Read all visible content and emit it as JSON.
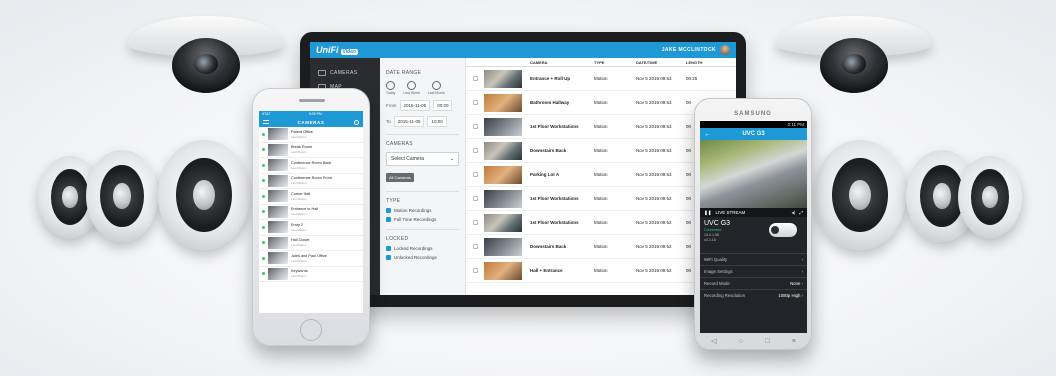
{
  "tablet": {
    "logo": "UniFi",
    "logo_badge": "Video",
    "user": "JAKE MCCLINTOCK",
    "sidebar": [
      {
        "label": "CAMERAS",
        "icon": "camera-icon"
      },
      {
        "label": "MAP",
        "icon": "map-icon"
      }
    ],
    "filters": {
      "date_range_heading": "DATE RANGE",
      "quick_ranges": [
        "Today",
        "Last Week",
        "Last Month"
      ],
      "from_label": "From",
      "from_date": "2015-11-05",
      "from_time": "00:00",
      "to_label": "To",
      "to_date": "2015-11-05",
      "to_time": "10:00",
      "cameras_heading": "CAMERAS",
      "select_camera": "Select Camera",
      "all_cameras_chip": "All Cameras",
      "type_heading": "TYPE",
      "type_options": [
        "Motion Recordings",
        "Full Time Recordings"
      ],
      "locked_heading": "LOCKED",
      "locked_options": [
        "Locked Recordings",
        "Unlocked Recordings"
      ]
    },
    "table": {
      "headers": [
        "",
        "",
        "CAMERA",
        "TYPE",
        "DATE/TIME",
        "LENGTH"
      ],
      "rows": [
        {
          "camera": "Entrance + Roll Up",
          "type": "Motion",
          "datetime": "Nov 5 2015 09:53",
          "length": "00:25"
        },
        {
          "camera": "Bathroom Hallway",
          "type": "Motion",
          "datetime": "Nov 5 2015 09:53",
          "length": "00"
        },
        {
          "camera": "1st Floor Workstations",
          "type": "Motion",
          "datetime": "Nov 5 2015 09:53",
          "length": "00"
        },
        {
          "camera": "Downstairs Back",
          "type": "Motion",
          "datetime": "Nov 5 2015 09:53",
          "length": "00"
        },
        {
          "camera": "Parking Lot A",
          "type": "Motion",
          "datetime": "Nov 5 2015 09:53",
          "length": "00"
        },
        {
          "camera": "1st Floor Workstations",
          "type": "Motion",
          "datetime": "Nov 5 2015 09:52",
          "length": "00"
        },
        {
          "camera": "1st Floor Workstations",
          "type": "Motion",
          "datetime": "Nov 5 2015 09:52",
          "length": "00"
        },
        {
          "camera": "Downstairs Back",
          "type": "Motion",
          "datetime": "Nov 5 2015 09:52",
          "length": "00"
        },
        {
          "camera": "Hall + Entrance",
          "type": "Motion",
          "datetime": "Nov 5 2015 09:52",
          "length": "00"
        }
      ]
    }
  },
  "iphone": {
    "carrier": "AT&T",
    "time": "9:09 PM",
    "title": "CAMERAS",
    "cameras": [
      {
        "name": "Patent Office",
        "sub": "Last Motion"
      },
      {
        "name": "Break Room",
        "sub": "Last Motion"
      },
      {
        "name": "Conference Room Back",
        "sub": "Last Motion"
      },
      {
        "name": "Conference Room Front",
        "sub": "Last Motion"
      },
      {
        "name": "Corner Hall",
        "sub": "Last Motion"
      },
      {
        "name": "Entrance to Hall",
        "sub": "Last Motion"
      },
      {
        "name": "Entry 2",
        "sub": "Last Motion"
      },
      {
        "name": "Hall Closet",
        "sub": "Last Motion"
      },
      {
        "name": "Jules and Paul Office",
        "sub": "Last Motion"
      },
      {
        "name": "Keywords",
        "sub": "Last Motion"
      }
    ]
  },
  "android": {
    "brand": "SAMSUNG",
    "time": "2:11 PM",
    "title": "UVC G3",
    "live_label": "LIVE STREAM",
    "camera_name": "UVC G3",
    "connected": "Connected",
    "ip": "10.0.1.58",
    "version": "v3.3.16",
    "settings": [
      {
        "label": "WiFi Quality",
        "value": ""
      },
      {
        "label": "Image Settings",
        "value": ""
      },
      {
        "label": "Record Mode",
        "value": "None"
      },
      {
        "label": "Recording Resolution",
        "value": "1080p High"
      }
    ]
  }
}
